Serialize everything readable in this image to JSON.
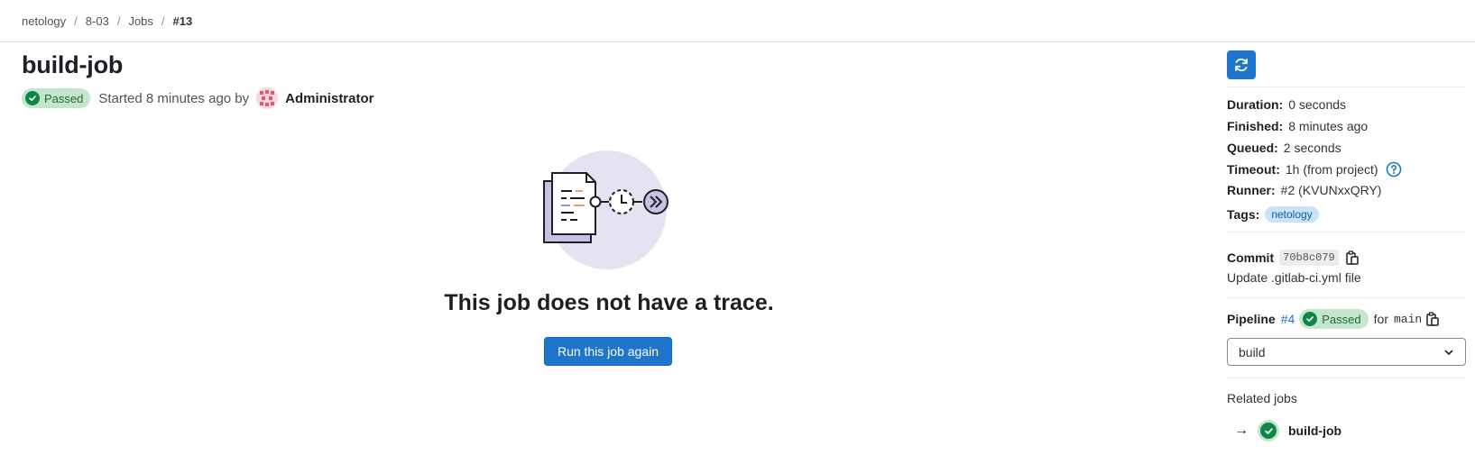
{
  "breadcrumb": {
    "items": [
      "netology",
      "8-03",
      "Jobs"
    ],
    "current": "#13",
    "separator": "/"
  },
  "job": {
    "title": "build-job",
    "status": "Passed",
    "started_text": "Started 8 minutes ago by",
    "author": "Administrator"
  },
  "empty_state": {
    "title": "This job does not have a trace.",
    "action": "Run this job again"
  },
  "sidebar": {
    "duration": {
      "label": "Duration:",
      "value": "0 seconds"
    },
    "finished": {
      "label": "Finished:",
      "value": "8 minutes ago"
    },
    "queued": {
      "label": "Queued:",
      "value": "2 seconds"
    },
    "timeout": {
      "label": "Timeout:",
      "value": "1h (from project)"
    },
    "runner": {
      "label": "Runner:",
      "value": "#2 (KVUNxxQRY)"
    },
    "tags": {
      "label": "Tags:",
      "value": "netology"
    },
    "commit": {
      "label": "Commit",
      "sha": "70b8c079",
      "message": "Update .gitlab-ci.yml file"
    },
    "pipeline": {
      "label": "Pipeline",
      "id": "#4",
      "status": "Passed",
      "for_text": "for",
      "ref": "main"
    },
    "stage_select": {
      "value": "build"
    },
    "related": {
      "title": "Related jobs",
      "jobs": [
        {
          "arrow": "→",
          "name": "build-job"
        }
      ]
    }
  },
  "colors": {
    "primary": "#1f75cb",
    "success": "#108548",
    "success_bg": "#c3e6cd",
    "tag_bg": "#cbe2f9"
  }
}
